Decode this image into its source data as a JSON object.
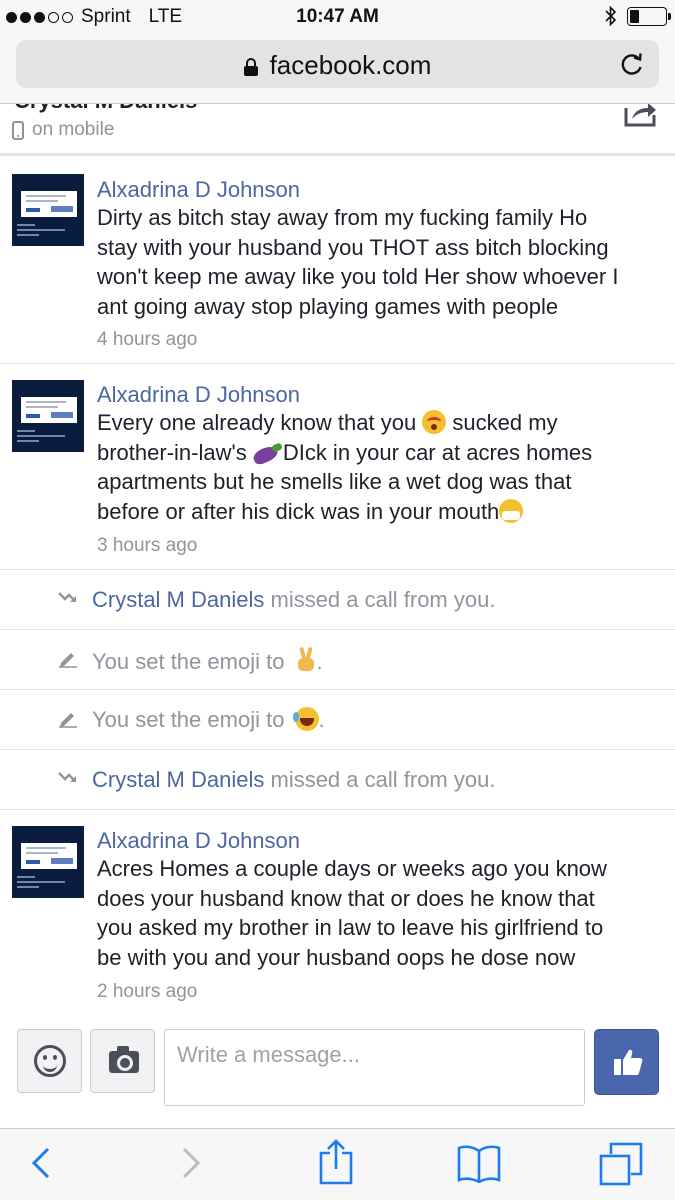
{
  "status_bar": {
    "carrier": "Sprint",
    "network": "LTE",
    "time": "10:47 AM",
    "signal_bars_filled": 3,
    "signal_bars_total": 5,
    "battery_level": 0.25,
    "bluetooth": "bluetooth-icon"
  },
  "browser": {
    "url": "facebook.com",
    "secure": true
  },
  "conversation": {
    "name": "Crystal M Daniels",
    "status": "on mobile"
  },
  "messages": [
    {
      "author": "Alxadrina D Johnson",
      "lines": [
        "Dirty as bitch stay away from my fucking family Ho",
        "stay with your husband you THOT ass bitch blocking",
        "won't keep me away like you told Her show whoever I",
        "ant going away stop playing games with people"
      ],
      "time": "4 hours ago"
    },
    {
      "author": "Alxadrina D Johnson",
      "line1": "Every one already know that you",
      "line1_end": " sucked my",
      "line2": "brother-in-law's ",
      "line2_end": "DIck in your car at acres homes",
      "line3": "apartments but he smells like a wet dog was that",
      "line4": "before or after his dick was in your mouth",
      "time": "3 hours ago"
    },
    {
      "author": "Alxadrina D Johnson",
      "lines": [
        "Acres Homes a couple days or weeks ago you know",
        "does your husband know that or does he know that",
        "you asked my brother in law to leave his girlfriend to",
        "be with you and your husband oops he dose now"
      ],
      "time": "2 hours ago"
    }
  ],
  "events": [
    {
      "name": "Crystal M Daniels",
      "text": " missed a call from you."
    },
    {
      "text": "You set the emoji to ",
      "emoji": "victory-hand"
    },
    {
      "text": "You set the emoji to ",
      "emoji": "tears-of-joy"
    },
    {
      "name": "Crystal M Daniels",
      "text": " missed a call from you."
    }
  ],
  "composer": {
    "placeholder": "Write a message..."
  }
}
